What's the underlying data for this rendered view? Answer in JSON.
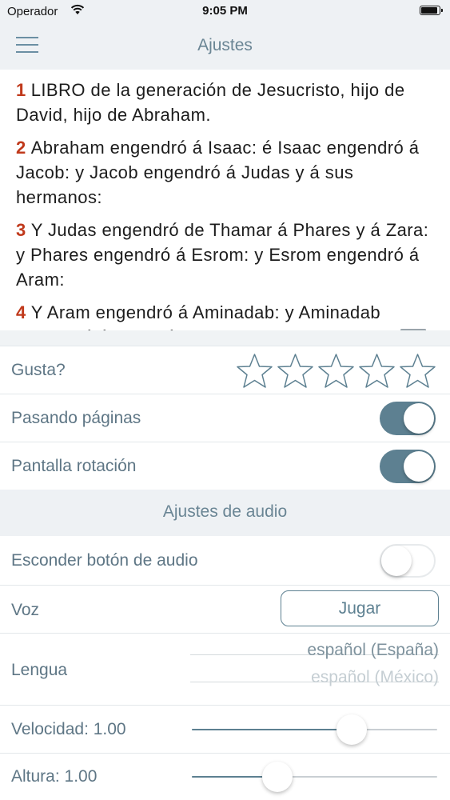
{
  "status_bar": {
    "carrier": "Operador",
    "time": "9:05 PM"
  },
  "nav": {
    "title": "Ajustes"
  },
  "preview": {
    "verses": [
      {
        "num": "1",
        "text": "LIBRO de la generación de Jesucristo, hijo de David, hijo de Abraham."
      },
      {
        "num": "2",
        "text": "Abraham engendró á Isaac: é Isaac engendró á Jacob: y Jacob engendró á Judas y á sus hermanos:"
      },
      {
        "num": "3",
        "text": "Y Judas engendró de Thamar á Phares y á Zara: y Phares engendró á Esrom: y Esrom engendró á Aram:"
      },
      {
        "num": "4",
        "text": "Y Aram engendró á Aminadab: y Aminadab engendró á Naassón: y"
      }
    ]
  },
  "settings": {
    "rating_label": "Gusta?",
    "rating_value": 0,
    "rating_max": 5,
    "page_turn_label": "Pasando páginas",
    "page_turn_on": true,
    "rotation_label": "Pantalla rotación",
    "rotation_on": true
  },
  "audio": {
    "section_title": "Ajustes de audio",
    "hide_button_label": "Esconder botón de audio",
    "hide_button_on": false,
    "voice_label": "Voz",
    "play_button": "Jugar",
    "language_label": "Lengua",
    "language_selected": "español (España)",
    "language_next": "español (México)",
    "speed_label": "Velocidad: 1.00",
    "speed_fraction": 0.65,
    "pitch_label": "Altura: 1.00",
    "pitch_fraction": 0.35
  },
  "colors": {
    "accent": "#5d8091",
    "verse_number": "#c0391b",
    "label": "#5e7685"
  }
}
